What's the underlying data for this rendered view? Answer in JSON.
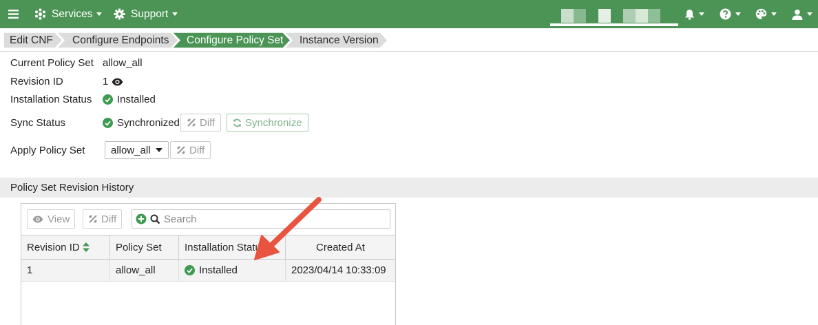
{
  "topbar": {
    "services_label": "Services",
    "support_label": "Support",
    "bg_color": "#4b9456"
  },
  "breadcrumb": [
    {
      "label": "Edit CNF",
      "active": false
    },
    {
      "label": "Configure Endpoints",
      "active": false
    },
    {
      "label": "Configure Policy Set",
      "active": true
    },
    {
      "label": "Instance Version",
      "active": false
    }
  ],
  "properties": {
    "current_policy_set": {
      "label": "Current Policy Set",
      "value": "allow_all"
    },
    "revision_id": {
      "label": "Revision ID",
      "value": "1"
    },
    "installation_status": {
      "label": "Installation Status",
      "value": "Installed"
    },
    "sync_status": {
      "label": "Sync Status",
      "value": "Synchronized",
      "diff_label": "Diff",
      "synchronize_label": "Synchronize"
    },
    "apply_policy_set": {
      "label": "Apply Policy Set",
      "selected": "allow_all",
      "diff_label": "Diff"
    }
  },
  "history": {
    "section_title": "Policy Set Revision History",
    "toolbar": {
      "view_label": "View",
      "diff_label": "Diff",
      "search_placeholder": "Search"
    },
    "columns": [
      "Revision ID",
      "Policy Set",
      "Installation Status",
      "Created At"
    ],
    "rows": [
      {
        "revision_id": "1",
        "policy_set": "allow_all",
        "installation_status": "Installed",
        "created_at": "2023/04/14 10:33:09"
      }
    ]
  },
  "colors": {
    "accent_green": "#4b9456",
    "status_green": "#3f9a52",
    "annotation_arrow": "#e8543f"
  }
}
